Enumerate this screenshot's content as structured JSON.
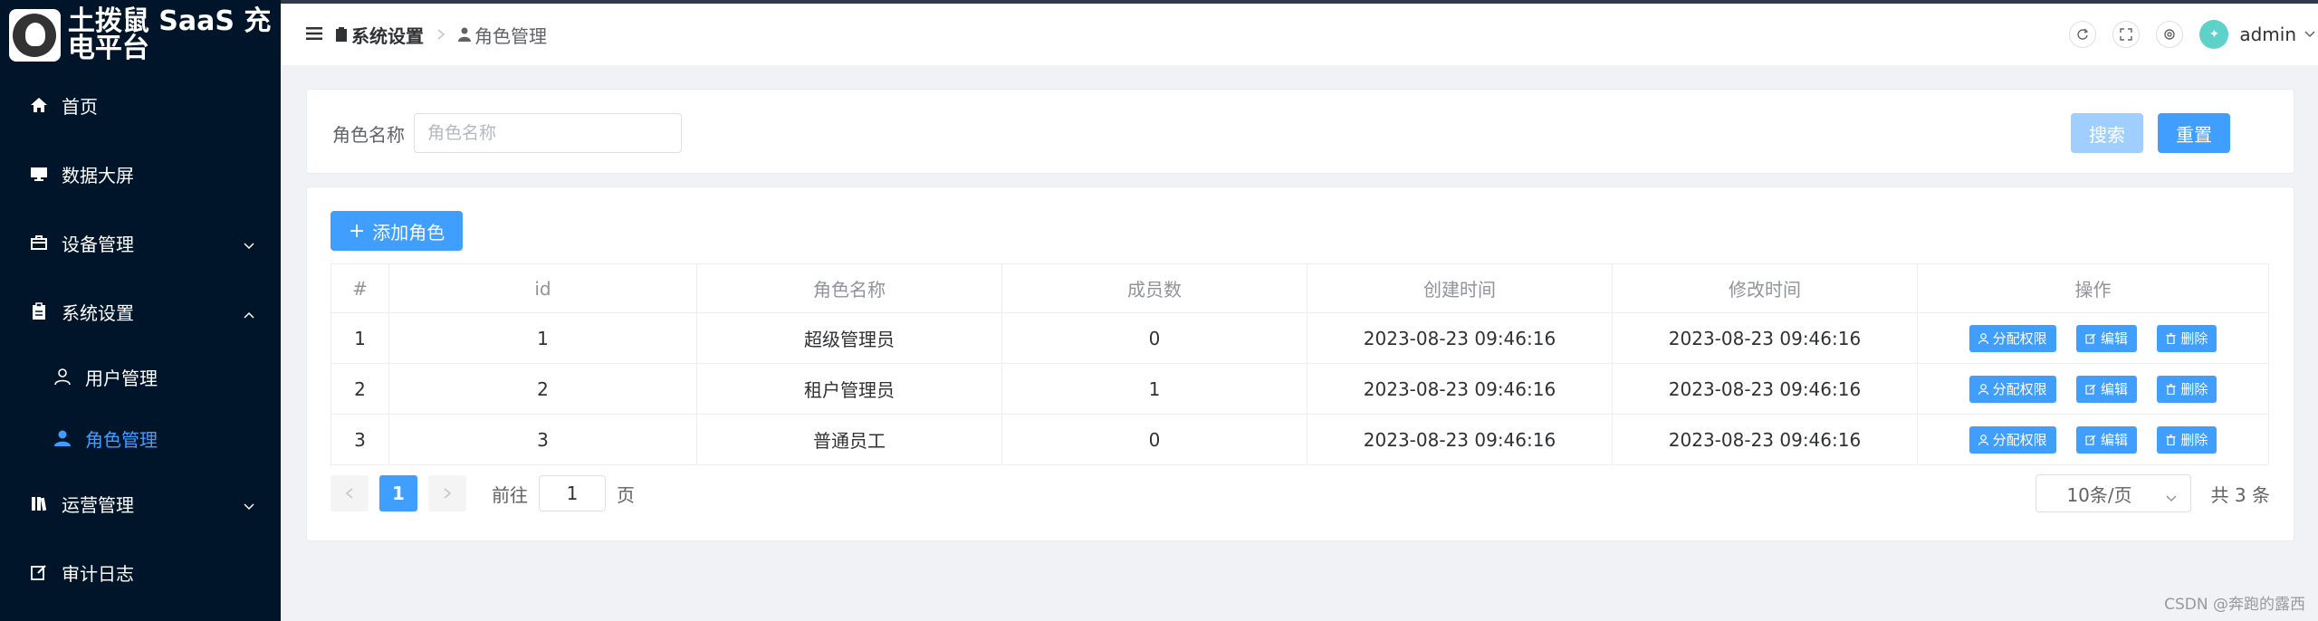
{
  "app": {
    "title": "土拨鼠 SaaS 充电平台"
  },
  "sidebar": {
    "items": [
      {
        "label": "首页"
      },
      {
        "label": "数据大屏"
      },
      {
        "label": "设备管理"
      },
      {
        "label": "系统设置"
      },
      {
        "label": "运营管理"
      },
      {
        "label": "审计日志"
      }
    ],
    "sub_items": [
      {
        "label": "用户管理"
      },
      {
        "label": "角色管理"
      }
    ]
  },
  "breadcrumb": {
    "level1": "系统设置",
    "level2": "角色管理"
  },
  "header": {
    "username": "admin"
  },
  "search": {
    "label": "角色名称",
    "placeholder": "角色名称",
    "search_label": "搜索",
    "reset_label": "重置"
  },
  "toolbar": {
    "add_label": "添加角色"
  },
  "table": {
    "headers": {
      "index": "#",
      "id": "id",
      "name": "角色名称",
      "members": "成员数",
      "created": "创建时间",
      "modified": "修改时间",
      "ops": "操作"
    },
    "rows": [
      {
        "index": "1",
        "id": "1",
        "name": "超级管理员",
        "members": "0",
        "created": "2023-08-23 09:46:16",
        "modified": "2023-08-23 09:46:16"
      },
      {
        "index": "2",
        "id": "2",
        "name": "租户管理员",
        "members": "1",
        "created": "2023-08-23 09:46:16",
        "modified": "2023-08-23 09:46:16"
      },
      {
        "index": "3",
        "id": "3",
        "name": "普通员工",
        "members": "0",
        "created": "2023-08-23 09:46:16",
        "modified": "2023-08-23 09:46:16"
      }
    ],
    "actions": {
      "assign": "分配权限",
      "edit": "编辑",
      "delete": "删除"
    }
  },
  "pagination": {
    "current_page": "1",
    "goto_prefix": "前往",
    "goto_value": "1",
    "goto_suffix": "页",
    "page_size": "10条/页",
    "total": "共 3 条"
  },
  "watermark": "CSDN @奔跑的露西",
  "colors": {
    "primary": "#409eff",
    "sidebar_bg": "#001529",
    "primary_disabled": "#a0cfff"
  }
}
